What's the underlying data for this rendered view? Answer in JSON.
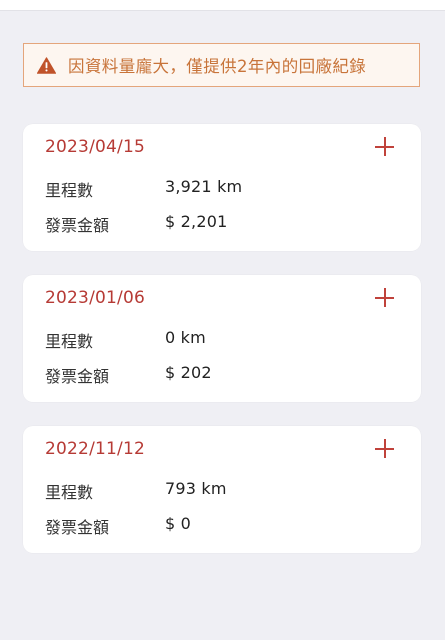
{
  "notice": {
    "icon": "warning-triangle-icon",
    "text": "因資料量龐大，僅提供2年內的回廠紀錄",
    "color": "#c8743a",
    "border_color": "#e4a57b"
  },
  "labels": {
    "mileage": "里程數",
    "invoice_amount": "發票金額"
  },
  "records": [
    {
      "date": "2023/04/15",
      "mileage": "3,921 km",
      "invoice": "$ 2,201"
    },
    {
      "date": "2023/01/06",
      "mileage": "0 km",
      "invoice": "$ 202"
    },
    {
      "date": "2022/11/12",
      "mileage": "793 km",
      "invoice": "$ 0"
    }
  ],
  "colors": {
    "accent": "#b63a35",
    "background": "#efeff4",
    "card": "#ffffff"
  }
}
